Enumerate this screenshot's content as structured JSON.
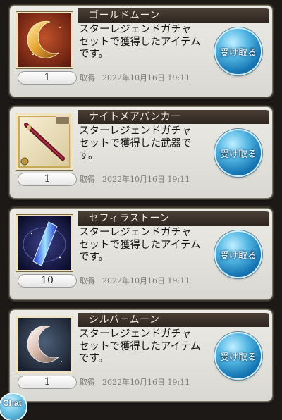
{
  "items": [
    {
      "name": "ゴールドムーン",
      "desc_lines": [
        "スターレジェンドガチャ",
        "セットで獲得したアイテム",
        "です。"
      ],
      "quantity": "1",
      "acquired_label": "取得",
      "acquired_date": "2022年10月16日 19:11",
      "receive_label": "受け取る"
    },
    {
      "name": "ナイトメアバンカー",
      "desc_lines": [
        "スターレジェンドガチャ",
        "セットで獲得した武器で",
        "す。"
      ],
      "quantity": "1",
      "acquired_label": "取得",
      "acquired_date": "2022年10月16日 19:11",
      "receive_label": "受け取る"
    },
    {
      "name": "セフィラストーン",
      "desc_lines": [
        "スターレジェンドガチャ",
        "セットで獲得したアイテム",
        "です。"
      ],
      "quantity": "10",
      "acquired_label": "取得",
      "acquired_date": "2022年10月16日 19:11",
      "receive_label": "受け取る"
    },
    {
      "name": "シルバームーン",
      "desc_lines": [
        "スターレジェンドガチャ",
        "セットで獲得したアイテム",
        "です。"
      ],
      "quantity": "1",
      "acquired_label": "取得",
      "acquired_date": "2022年10月16日 19:11",
      "receive_label": "受け取る"
    }
  ],
  "icons": [
    "gold-moon-icon",
    "nightmare-banker-weapon-icon",
    "sephira-stone-icon",
    "silver-moon-icon",
    "chat-icon"
  ],
  "colors": {
    "header_bar": "#3b312a",
    "receive_button": "#2f8fcb",
    "card_bg": "#e6e5e0"
  },
  "chat_label": "Chat"
}
